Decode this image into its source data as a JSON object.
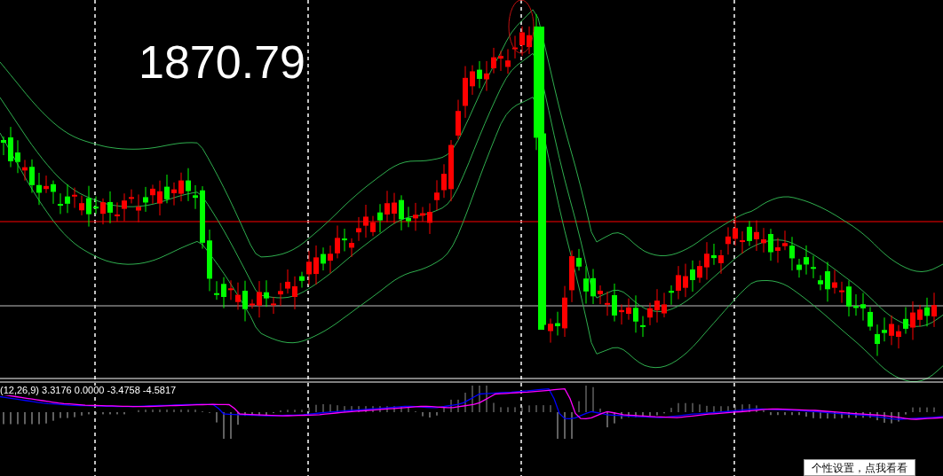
{
  "price_label": "1870.79",
  "indicator": {
    "label": "(12,26,9) 3.3176 0.0000 -3.4758 -4.5817"
  },
  "popup": {
    "text": "个性设置，点我看看"
  }
}
